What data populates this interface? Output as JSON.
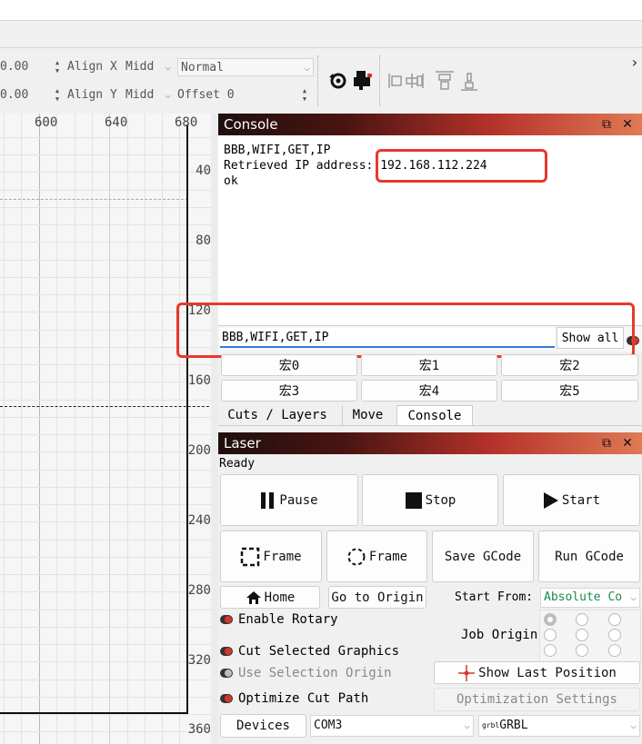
{
  "toolbar": {
    "x_value": "0.00",
    "y_value": "0.00",
    "align_x_label": "Align X",
    "align_y_label": "Align Y",
    "align_x_value": "Midd",
    "align_y_value": "Midd",
    "mode_value": "Normal",
    "offset_label": "Offset",
    "offset_value": "0",
    "more_icon": "chevron-right-icon"
  },
  "canvas": {
    "ruler_x": [
      "600",
      "640",
      "680"
    ],
    "ruler_y": [
      "40",
      "80",
      "120",
      "160",
      "200",
      "240",
      "280",
      "320",
      "360"
    ]
  },
  "console": {
    "title": "Console",
    "output_lines": [
      "BBB,WIFI,GET,IP",
      "Retrieved IP address:",
      "ok"
    ],
    "ip_address": "192.168.112.224",
    "command_input": "BBB,WIFI,GET,IP",
    "show_all_label": "Show all",
    "macros": [
      "宏0",
      "宏1",
      "宏2",
      "宏3",
      "宏4",
      "宏5"
    ]
  },
  "tabs": [
    "Cuts / Layers",
    "Move",
    "Console"
  ],
  "laser": {
    "title": "Laser",
    "status": "Ready",
    "pause": "Pause",
    "stop": "Stop",
    "start": "Start",
    "frame1": "Frame",
    "frame2": "Frame",
    "save_gcode": "Save GCode",
    "run_gcode": "Run GCode",
    "home": "Home",
    "go_to_origin": "Go to Origin",
    "start_from_label": "Start From:",
    "start_from_value": "Absolute Co",
    "job_origin_label": "Job Origin",
    "enable_rotary": "Enable Rotary",
    "cut_selected": "Cut Selected Graphics",
    "use_selection_origin": "Use Selection Origin",
    "optimize_cut_path": "Optimize Cut Path",
    "show_last_position": "Show Last Position",
    "optimization_settings": "Optimization Settings",
    "devices": "Devices",
    "port": "COM3",
    "grbl_prefix": "grbl",
    "controller": "GRBL"
  },
  "colors": {
    "accent_red": "#e8392a",
    "input_underline": "#2f7fd6"
  }
}
